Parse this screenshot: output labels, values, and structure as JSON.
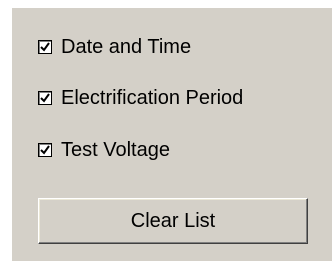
{
  "options": [
    {
      "label": "Date and Time",
      "checked": true
    },
    {
      "label": "Electrification Period",
      "checked": true
    },
    {
      "label": "Test Voltage",
      "checked": true
    }
  ],
  "buttons": {
    "clear_label": "Clear List"
  },
  "icons": {
    "checkmark": "check-icon"
  },
  "colors": {
    "panel_background": "#d4d0c8",
    "page_background": "#ffffff",
    "text": "#000000"
  }
}
